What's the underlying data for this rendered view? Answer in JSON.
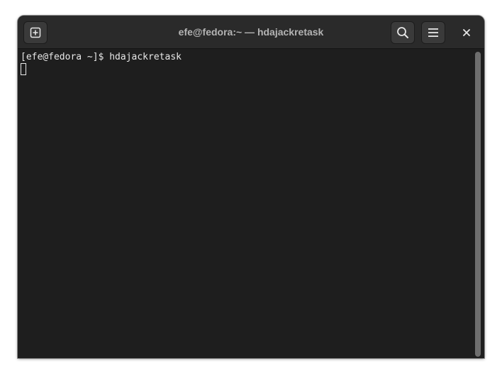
{
  "window": {
    "title": "efe@fedora:~ — hdajackretask"
  },
  "headerbar": {
    "new_tab_icon": "new-tab-icon",
    "search_icon": "search-icon",
    "menu_icon": "hamburger-menu-icon",
    "close_icon": "close-icon"
  },
  "terminal": {
    "lines": [
      "[efe@fedora ~]$ hdajackretask"
    ]
  },
  "colors": {
    "terminal_bg": "#1e1e1e",
    "headerbar_bg": "#2a2a2a",
    "text": "#e8e8e8",
    "title_text": "#b4b4b4"
  }
}
